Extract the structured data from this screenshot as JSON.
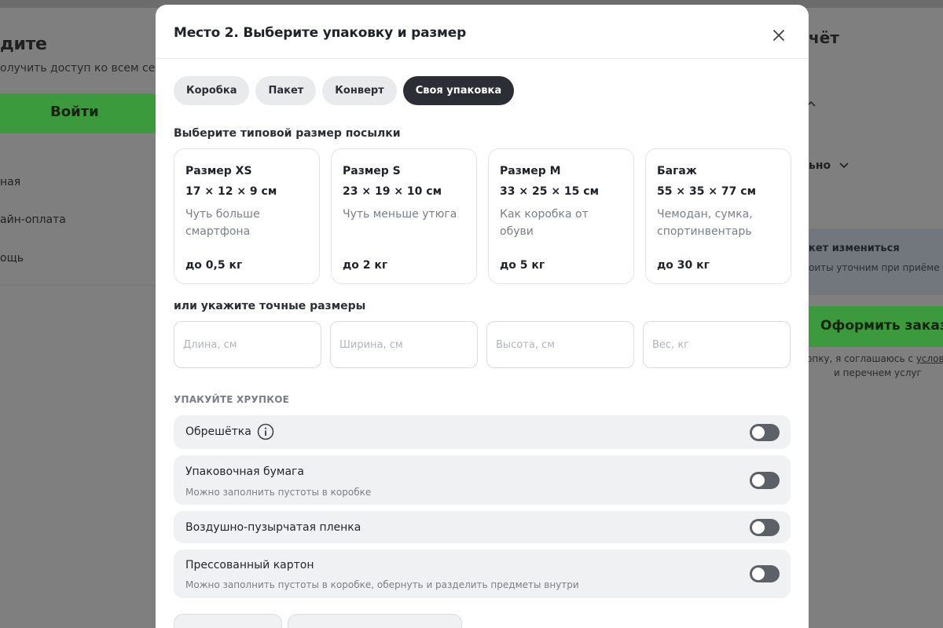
{
  "background": {
    "left_title": "дите",
    "left_subtitle": "олучить доступ ко всем сервис",
    "login_label": "Войти",
    "left_items": [
      "ная",
      "айн-оплата",
      "ощь"
    ],
    "right_title": "чёт",
    "right_caret": "^",
    "right_dropdown": "ьно",
    "info_title": "кет измениться",
    "info_text": "оиты уточним при приёме в",
    "order_label": "Оформить заказ",
    "terms_line1_prefix": "опку, я соглашаюсь с ",
    "terms_line1_link": "услови",
    "terms_line2": "и перечнем услуг"
  },
  "modal": {
    "title": "Место 2. Выберите упаковку и размер",
    "tabs": [
      {
        "label": "Коробка",
        "active": false
      },
      {
        "label": "Пакет",
        "active": false
      },
      {
        "label": "Конверт",
        "active": false
      },
      {
        "label": "Своя упаковка",
        "active": true
      }
    ],
    "sizes_label": "Выберите типовой размер посылки",
    "sizes": [
      {
        "name": "Размер XS",
        "dims": "17 × 12 × 9 см",
        "desc": "Чуть больше смартфона",
        "weight": "до 0,5 кг"
      },
      {
        "name": "Размер S",
        "dims": "23 × 19 × 10 см",
        "desc": "Чуть меньше утюга",
        "weight": "до 2 кг"
      },
      {
        "name": "Размер M",
        "dims": "33 × 25 × 15 см",
        "desc": "Как коробка от обуви",
        "weight": "до 5 кг"
      },
      {
        "name": "Багаж",
        "dims": "55 × 35 × 77 см",
        "desc": "Чемодан, сумка, спортинвентарь",
        "weight": "до 30 кг"
      }
    ],
    "exact_label": "или укажите точные размеры",
    "inputs": [
      {
        "placeholder": "Длина, см",
        "value": ""
      },
      {
        "placeholder": "Ширина, см",
        "value": ""
      },
      {
        "placeholder": "Высота, см",
        "value": ""
      },
      {
        "placeholder": "Вес, кг",
        "value": ""
      }
    ],
    "fragile_label": "УПАКУЙТЕ ХРУПКОЕ",
    "options": [
      {
        "title": "Обрешётка",
        "subtitle": "",
        "enabled": false
      },
      {
        "title": "Упаковочная бумага",
        "subtitle": "Можно заполнить пустоты в коробке",
        "enabled": false
      },
      {
        "title": "Воздушно-пузырчатая пленка",
        "subtitle": "",
        "enabled": false
      },
      {
        "title": "Прессованный картон",
        "subtitle": "Можно заполнить пустоты в коробке, обернуть и разделить предметы внутри",
        "enabled": false
      }
    ]
  },
  "colors": {
    "overlay": "#7f7f7f",
    "accent_green": "#3a9a3c",
    "tab_active": "#2b2f35",
    "toggle_off": "#5c6168"
  }
}
